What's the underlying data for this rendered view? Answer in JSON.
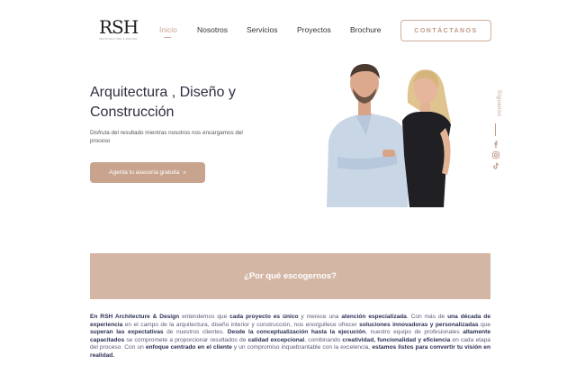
{
  "brand": {
    "logo_text": "RSH",
    "logo_sub": "ARCHITECTURE & DESIGN"
  },
  "nav": {
    "items": [
      {
        "label": "Inicio",
        "active": true
      },
      {
        "label": "Nosotros"
      },
      {
        "label": "Servicios"
      },
      {
        "label": "Proyectos"
      },
      {
        "label": "Brochure"
      }
    ],
    "cta": "CONTÁCTANOS"
  },
  "hero": {
    "title": "Arquitectura , Diseño y Construcción",
    "subtitle": "Disfruta del resultado mientras nosotros nos encargamos del proceso",
    "button_label": "Agenta tu asesoría gratuita",
    "button_arrow": "»"
  },
  "social": {
    "label": "Síguenos",
    "icons": [
      "facebook-icon",
      "instagram-icon",
      "tiktok-icon"
    ]
  },
  "why": {
    "title": "¿Por qué escogernos?"
  },
  "about": {
    "segments": [
      {
        "t": "En RSH Architecture & Design",
        "b": true
      },
      {
        "t": " entendemos que ",
        "b": false
      },
      {
        "t": "cada proyecto es único",
        "b": true
      },
      {
        "t": " y merece una ",
        "b": false
      },
      {
        "t": "atención especializada",
        "b": true
      },
      {
        "t": ". Con más de ",
        "b": false
      },
      {
        "t": "una década de experiencia",
        "b": true
      },
      {
        "t": " en el campo de la arquitectura, diseño interior y construcción, nos enorgullece ofrecer ",
        "b": false
      },
      {
        "t": "soluciones innovadoras y personalizadas",
        "b": true
      },
      {
        "t": " que ",
        "b": false
      },
      {
        "t": "superan las expectativas",
        "b": true
      },
      {
        "t": " de nuestros clientes. ",
        "b": false
      },
      {
        "t": "Desde la conceptualización hasta la ejecución",
        "b": true
      },
      {
        "t": ", nuestro equipo de profesionales ",
        "b": false
      },
      {
        "t": "altamente capacitados",
        "b": true
      },
      {
        "t": " se compromete a proporcionar resultados de ",
        "b": false
      },
      {
        "t": "calidad excepcional",
        "b": true
      },
      {
        "t": ", combinando ",
        "b": false
      },
      {
        "t": "creatividad, funcionalidad y eficiencia",
        "b": true
      },
      {
        "t": " en cada etapa del proceso. Con un ",
        "b": false
      },
      {
        "t": "enfoque centrado en el cliente",
        "b": true
      },
      {
        "t": " y un compromiso inquebrantable con la excelencia, ",
        "b": false
      },
      {
        "t": "estamos listos para convertir tu visión en realidad.",
        "b": true
      }
    ]
  },
  "colors": {
    "accent": "#c8a48f",
    "band": "#d4b6a5",
    "text_dark": "#2e2e40"
  }
}
